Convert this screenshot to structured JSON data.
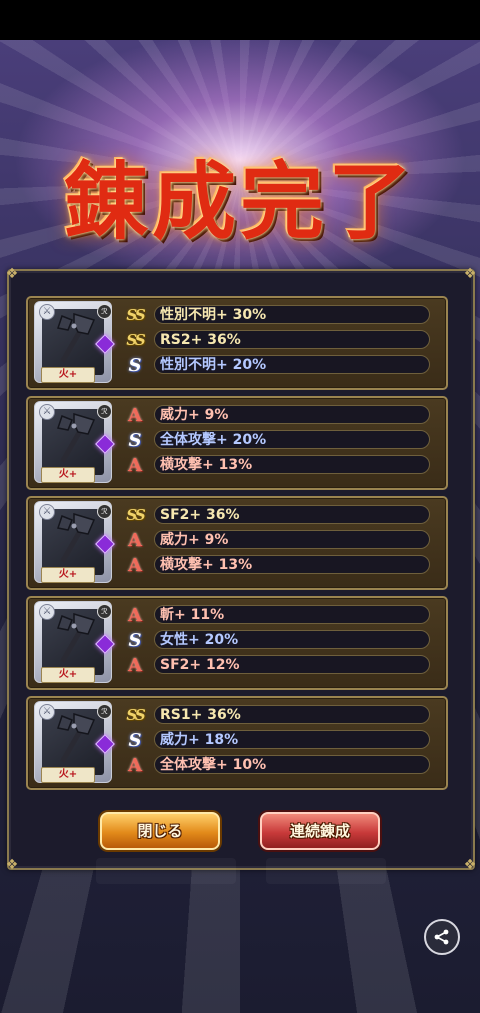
{
  "title": "錬成完了",
  "buttons": {
    "close_label": "閉じる",
    "continue_label": "連続錬成"
  },
  "results": [
    {
      "element": "火+",
      "skills": [
        {
          "rank": "SS",
          "text": "性別不明+ 30%"
        },
        {
          "rank": "SS",
          "text": "RS2+ 36%"
        },
        {
          "rank": "S",
          "text": "性別不明+ 20%"
        }
      ]
    },
    {
      "element": "火+",
      "skills": [
        {
          "rank": "A",
          "text": "威力+ 9%"
        },
        {
          "rank": "S",
          "text": "全体攻撃+ 20%"
        },
        {
          "rank": "A",
          "text": "横攻撃+ 13%"
        }
      ]
    },
    {
      "element": "火+",
      "skills": [
        {
          "rank": "SS",
          "text": "SF2+ 36%"
        },
        {
          "rank": "A",
          "text": "威力+ 9%"
        },
        {
          "rank": "A",
          "text": "横攻撃+ 13%"
        }
      ]
    },
    {
      "element": "火+",
      "skills": [
        {
          "rank": "A",
          "text": "斬+ 11%"
        },
        {
          "rank": "S",
          "text": "女性+ 20%"
        },
        {
          "rank": "A",
          "text": "SF2+ 12%"
        }
      ]
    },
    {
      "element": "火+",
      "skills": [
        {
          "rank": "SS",
          "text": "RS1+ 36%"
        },
        {
          "rank": "S",
          "text": "威力+ 18%"
        },
        {
          "rank": "A",
          "text": "全体攻撃+ 10%"
        }
      ]
    }
  ],
  "icons": {
    "share": "share-icon",
    "weapon": "axe-icon",
    "gem": "gem-icon"
  },
  "colors": {
    "title": "#e02b12",
    "close_button": "#e28a1a",
    "continue_button": "#c83a3a"
  }
}
